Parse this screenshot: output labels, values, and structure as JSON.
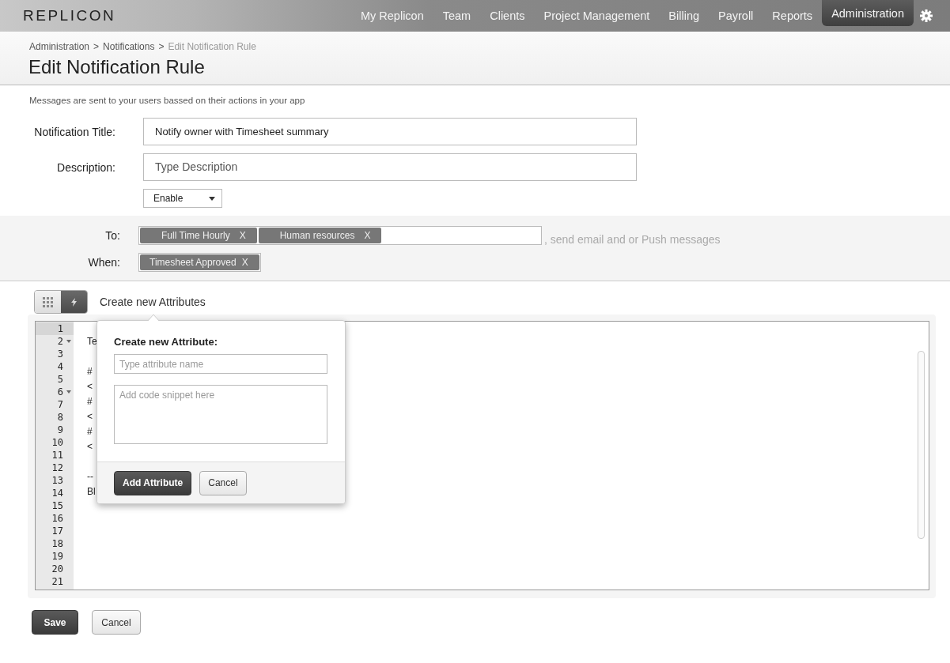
{
  "nav": {
    "logo": "REPLICON",
    "items": [
      {
        "label": "My Replicon",
        "selected": false
      },
      {
        "label": "Team",
        "selected": false
      },
      {
        "label": "Clients",
        "selected": false
      },
      {
        "label": "Project Management",
        "selected": false
      },
      {
        "label": "Billing",
        "selected": false
      },
      {
        "label": "Payroll",
        "selected": false
      },
      {
        "label": "Reports",
        "selected": false
      },
      {
        "label": "Administration",
        "selected": true
      }
    ]
  },
  "breadcrumb": [
    {
      "label": "Administration",
      "current": false
    },
    {
      "label": "Notifications",
      "current": false
    },
    {
      "label": "Edit Notification Rule",
      "current": true
    }
  ],
  "separators": [
    ">",
    ">"
  ],
  "title": "Edit Notification Rule",
  "intro": "Messages are sent to your users bassed on their actions in your app",
  "form": {
    "title_label": "Notification Title:",
    "title_value": "Notify owner with Timesheet summary",
    "description_label": "Description:",
    "description_placeholder": "Type Description",
    "status": "Enable"
  },
  "recipients": {
    "to_label": "To:",
    "to_tags": [
      {
        "label": "Full Time Hourly",
        "remove": "X"
      },
      {
        "label": "Human resources",
        "remove": "X"
      }
    ],
    "to_hint": ", send email and or Push messages",
    "when_label": "When:",
    "when_tags": [
      {
        "label": "Timesheet Approved",
        "remove": "X"
      }
    ]
  },
  "toolbar": {
    "views": [
      {
        "kind": "grid",
        "selected": false
      },
      {
        "kind": "bolt",
        "selected": true
      }
    ],
    "label": "Create new Attributes"
  },
  "editor": {
    "line_numbers": [
      {
        "n": "1",
        "selected": true,
        "fold": false
      },
      {
        "n": "2",
        "selected": false,
        "fold": true
      },
      {
        "n": "3",
        "selected": false,
        "fold": false
      },
      {
        "n": "4",
        "selected": false,
        "fold": false
      },
      {
        "n": "5",
        "selected": false,
        "fold": false
      },
      {
        "n": "6",
        "selected": false,
        "fold": true
      },
      {
        "n": "7",
        "selected": false,
        "fold": false
      },
      {
        "n": "8",
        "selected": false,
        "fold": false
      },
      {
        "n": "9",
        "selected": false,
        "fold": false
      },
      {
        "n": "10",
        "selected": false,
        "fold": false
      },
      {
        "n": "11",
        "selected": false,
        "fold": false
      },
      {
        "n": "12",
        "selected": false,
        "fold": false
      },
      {
        "n": "13",
        "selected": false,
        "fold": false
      },
      {
        "n": "14",
        "selected": false,
        "fold": false
      },
      {
        "n": "15",
        "selected": false,
        "fold": false
      },
      {
        "n": "16",
        "selected": false,
        "fold": false
      },
      {
        "n": "17",
        "selected": false,
        "fold": false
      },
      {
        "n": "18",
        "selected": false,
        "fold": false
      },
      {
        "n": "19",
        "selected": false,
        "fold": false
      },
      {
        "n": "20",
        "selected": false,
        "fold": false
      },
      {
        "n": "21",
        "selected": false,
        "fold": false
      }
    ],
    "code_blocks": [
      [
        "Te"
      ],
      [
        "#",
        "<",
        "#",
        "<",
        "#",
        "<"
      ],
      [
        "--",
        "Bl"
      ]
    ]
  },
  "popup": {
    "title": "Create new Attribute:",
    "name_placeholder": "Type attribute name",
    "snippet_placeholder": "Add code snippet here",
    "add": "Add Attribute",
    "cancel": "Cancel"
  },
  "actions": {
    "save": "Save",
    "cancel": "Cancel"
  }
}
